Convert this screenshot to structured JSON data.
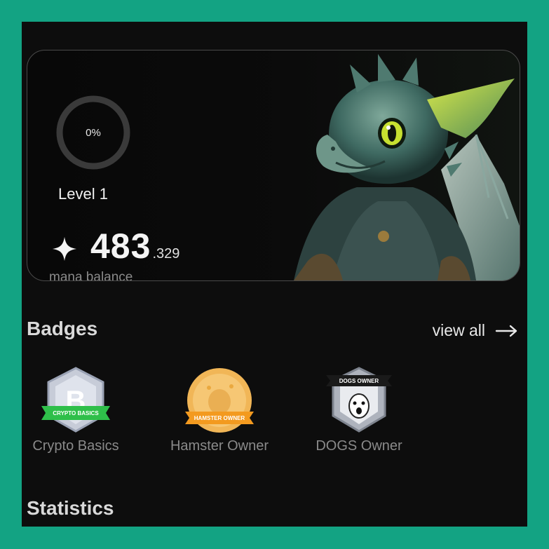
{
  "profile": {
    "progress_text": "0%",
    "progress_fraction": 0,
    "level_label": "Level 1",
    "balance_integer": "483",
    "balance_decimal": ".329",
    "balance_label": "mana balance",
    "balance_icon": "sparkle-icon",
    "mascot": "dragon-illustration"
  },
  "badges": {
    "title": "Badges",
    "view_all_label": "view all",
    "items": [
      {
        "label": "Crypto Basics",
        "ribbon": "CRYPTO BASICS",
        "color": "#2fbf4a"
      },
      {
        "label": "Hamster Owner",
        "ribbon": "HAMSTER OWNER",
        "color": "#f39a1f"
      },
      {
        "label": "DOGS Owner",
        "ribbon": "DOGS OWNER",
        "color": "#1a1a1a"
      }
    ]
  },
  "statistics": {
    "title": "Statistics"
  },
  "colors": {
    "frame": "#13a383",
    "background": "#0d0d0d",
    "muted_text": "#8a8a8a"
  }
}
